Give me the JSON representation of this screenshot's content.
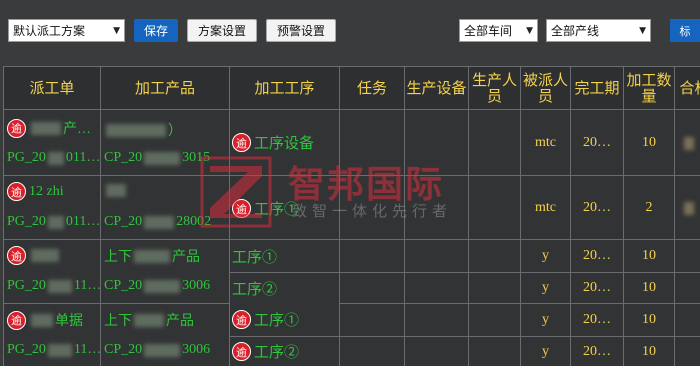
{
  "toolbar": {
    "scheme_select": "默认派工方案",
    "save": "保存",
    "scheme_settings": "方案设置",
    "alert_settings": "预警设置",
    "workshop_select": "全部车间",
    "line_select": "全部产线",
    "edge_button": "标"
  },
  "columns": [
    "派工单",
    "加工产品",
    "加工工序",
    "任务",
    "生产设备",
    "生产人员",
    "被派人员",
    "完工期",
    "加工数量",
    "合格"
  ],
  "badge": "逾",
  "rows": [
    {
      "order_name": "产…",
      "order_no_a": "PG_20",
      "order_no_b": "011…",
      "product_name_a": "",
      "product_name_b": "）",
      "product_no_a": "CP_20",
      "product_no_b": "3015",
      "process": "工序设备",
      "process_badge": true,
      "assignee": "mtc",
      "due": "20…",
      "qty": "10",
      "order_badge": true
    },
    {
      "order_name": "12 zhi",
      "order_no_a": "PG_20",
      "order_no_b": "011…",
      "product_name_a": "",
      "product_name_b": "",
      "product_no_a": "CP_20",
      "product_no_b": "28002",
      "process": "工序①",
      "process_badge": true,
      "assignee": "mtc",
      "due": "20…",
      "qty": "2",
      "order_badge": true
    }
  ],
  "pair_rows": [
    {
      "order_name": "",
      "order_no_a": "PG_20",
      "order_no_b": "11…",
      "product_name_a": "上下",
      "product_name_b": "产品",
      "product_no_a": "CP_20",
      "product_no_b": "3006",
      "proc1": "工序①",
      "proc2": "工序②",
      "badge_proc": false,
      "assignee": "y",
      "due": "20…",
      "qty1": "10",
      "qty2": "10"
    },
    {
      "order_name": "单据",
      "order_no_a": "PG_20",
      "order_no_b": "11…",
      "product_name_a": "上下",
      "product_name_b": "产品",
      "product_no_a": "CP_20",
      "product_no_b": "3006",
      "proc1": "工序①",
      "proc2": "工序②",
      "badge_proc": true,
      "assignee": "y",
      "due": "20…",
      "qty1": "10",
      "qty2": "10"
    }
  ],
  "watermark": {
    "title": "智邦国际",
    "subtitle": "致智一体化先行者"
  },
  "colors": {
    "header_text": "#f4d24a",
    "green_text": "#2fc43e",
    "badge": "#d8202a",
    "primary": "#1565c0"
  }
}
